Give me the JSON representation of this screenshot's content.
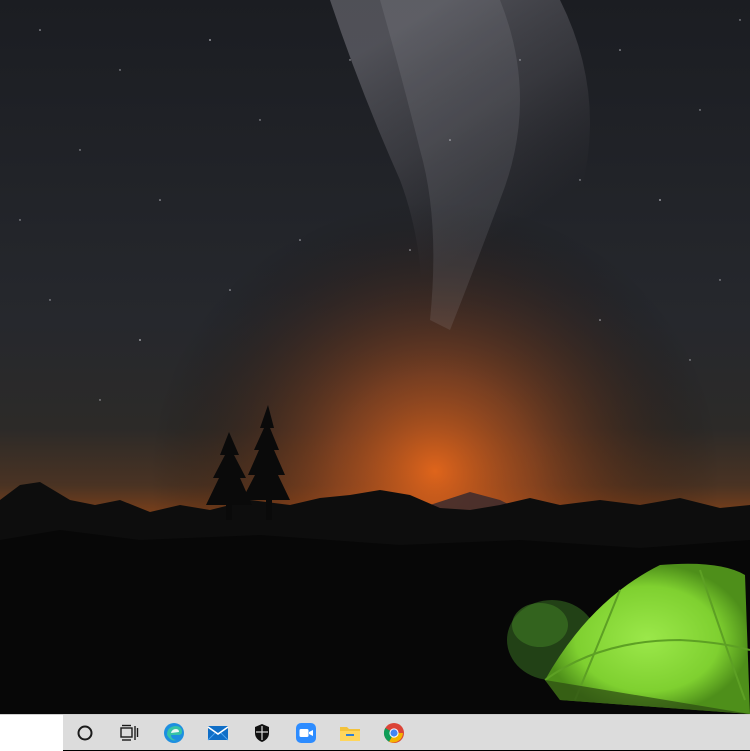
{
  "desktop": {
    "wallpaper": "night-sky-camping-scene"
  },
  "taskbar": {
    "search_box": {
      "placeholder": ""
    },
    "icons": [
      {
        "name": "cortana-icon"
      },
      {
        "name": "task-view-icon"
      },
      {
        "name": "edge-icon"
      },
      {
        "name": "mail-icon"
      },
      {
        "name": "security-shield-icon"
      },
      {
        "name": "zoom-icon"
      },
      {
        "name": "file-explorer-icon"
      },
      {
        "name": "chrome-icon"
      }
    ]
  },
  "colors": {
    "taskbar_bg": "#dcdcdc",
    "search_bg": "#ffffff",
    "tent_green": "#8fe03a",
    "horizon_glow": "#e0601a",
    "sky": "#1c1f26"
  }
}
